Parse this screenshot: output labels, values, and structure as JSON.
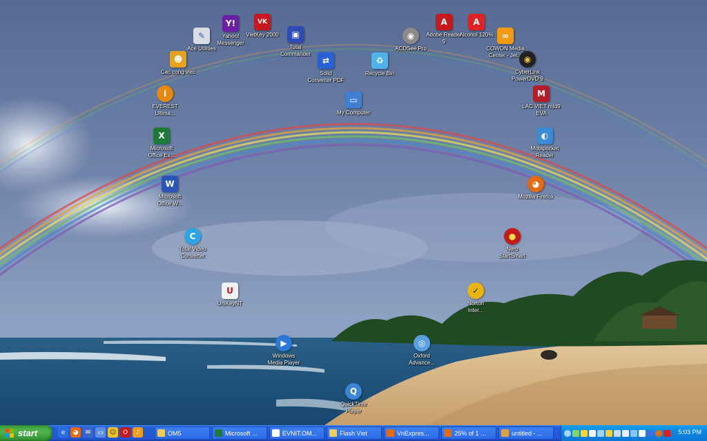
{
  "desktop_icons": [
    {
      "id": "ace-utilities",
      "label": "Ace Utilities",
      "icon": "ace-utilities-icon",
      "color": "#d8dce4",
      "glyph": "✎"
    },
    {
      "id": "yahoo-messenger",
      "label": "Yahoo!\nMessenger",
      "icon": "yahoo-messenger-icon",
      "color": "#6b1fa6",
      "glyph": "Y!"
    },
    {
      "id": "vietkey-2000",
      "label": "VietKey 2000",
      "icon": "vietkey-icon",
      "color": "#c8171d",
      "glyph": "VK"
    },
    {
      "id": "total-commander",
      "label": "Total\nCommander",
      "icon": "total-commander-icon",
      "color": "#2f4bb8",
      "glyph": "▣"
    },
    {
      "id": "acdsee-pro",
      "label": "ACDSee Pro",
      "icon": "acdsee-icon",
      "color": "#8a8a8a",
      "glyph": "◉"
    },
    {
      "id": "adobe-reader",
      "label": "Adobe Reader\n9",
      "icon": "adobe-reader-icon",
      "color": "#c8171d",
      "glyph": "A"
    },
    {
      "id": "alcohol-120",
      "label": "Alcohol 120%",
      "icon": "alcohol-icon",
      "color": "#e02222",
      "glyph": "A"
    },
    {
      "id": "cac-cong-viec",
      "label": "Cac cong viec",
      "icon": "person-icon",
      "color": "#e5a21c",
      "glyph": "☻"
    },
    {
      "id": "cowon-media-center",
      "label": "COWON Media\nCenter - Jet...",
      "icon": "cowon-icon",
      "color": "#f09b12",
      "glyph": "∞"
    },
    {
      "id": "solid-converter-pdf",
      "label": "Solid\nConverter PDF",
      "icon": "pdf-converter-icon",
      "color": "#2a5fd6",
      "glyph": "⇄"
    },
    {
      "id": "recycle-bin",
      "label": "Recycle Bin",
      "icon": "recycle-bin-icon",
      "color": "#4fb2e8",
      "glyph": "♻"
    },
    {
      "id": "cyberlink-powerdvd",
      "label": "CyberLink\nPowerDVD 9",
      "icon": "powerdvd-icon",
      "color": "#222222",
      "glyph": "◉"
    },
    {
      "id": "everest",
      "label": "EVEREST\nUltima...",
      "icon": "info-icon",
      "color": "#e58a0c",
      "glyph": "i"
    },
    {
      "id": "my-computer",
      "label": "My Computer",
      "icon": "my-computer-icon",
      "color": "#3e7fd3",
      "glyph": "▭"
    },
    {
      "id": "lac-viet",
      "label": "LAC VIET mtd9\nEVA",
      "icon": "lac-viet-icon",
      "color": "#b51d2a",
      "glyph": "M"
    },
    {
      "id": "microsoft-excel",
      "label": "Microsoft\nOffice Ex...",
      "icon": "excel-icon",
      "color": "#1f7a3a",
      "glyph": "X"
    },
    {
      "id": "mobipocket-reader",
      "label": "Mobipocket\nReader",
      "icon": "mobipocket-icon",
      "color": "#3a8ad6",
      "glyph": "◐"
    },
    {
      "id": "microsoft-word",
      "label": "Microsoft\nOffice W...",
      "icon": "word-icon",
      "color": "#2b55b8",
      "glyph": "W"
    },
    {
      "id": "mozilla-firefox",
      "label": "Mozilla Firefox",
      "icon": "firefox-icon",
      "color": "#e56a10",
      "glyph": "◕"
    },
    {
      "id": "total-video-converter",
      "label": "Total Video\nConverter",
      "icon": "video-converter-icon",
      "color": "#2ea4e8",
      "glyph": "C"
    },
    {
      "id": "nero-startsmart",
      "label": "Nero\nStartSmart",
      "icon": "nero-icon",
      "color": "#c41a1a",
      "glyph": "●"
    },
    {
      "id": "unikey-nt",
      "label": "UniKeyNT",
      "icon": "unikey-icon",
      "color": "#f2f2f2",
      "glyph": "U"
    },
    {
      "id": "norton-internet",
      "label": "Norton\nInter...",
      "icon": "norton-icon",
      "color": "#e8b40f",
      "glyph": "✓"
    },
    {
      "id": "windows-media-player",
      "label": "Windows\nMedia Player",
      "icon": "media-player-icon",
      "color": "#2a79d8",
      "glyph": "▶"
    },
    {
      "id": "oxford-advanced",
      "label": "Oxford\nAdvance...",
      "icon": "oxford-icon",
      "color": "#5aa0e0",
      "glyph": "◎"
    },
    {
      "id": "quicktime-player",
      "label": "QuickTime\nPlayer",
      "icon": "quicktime-icon",
      "color": "#3b86d6",
      "glyph": "Q"
    }
  ],
  "taskbar": {
    "start_label": "start",
    "quick_launch": [
      {
        "icon": "internet-explorer-icon",
        "color": "#2a6fe0",
        "glyph": "e"
      },
      {
        "icon": "firefox-icon",
        "color": "#e56a10",
        "glyph": "◕"
      },
      {
        "icon": "thunderbird-icon",
        "color": "#3a67c9",
        "glyph": "✉"
      },
      {
        "icon": "show-desktop-icon",
        "color": "#5b8fe5",
        "glyph": "▭"
      },
      {
        "icon": "yahoo-messenger-icon",
        "color": "#f2c21c",
        "glyph": "☺"
      },
      {
        "icon": "opera-icon",
        "color": "#c41a1a",
        "glyph": "O"
      },
      {
        "icon": "media-icon",
        "color": "#ee9d1a",
        "glyph": "♪"
      }
    ],
    "tasks": [
      {
        "label": "OM5",
        "icon": "folder-icon",
        "color": "#f0cc55"
      },
      {
        "label": "Microsoft ...",
        "icon": "excel-icon",
        "color": "#1f7a3a"
      },
      {
        "label": "EVNIT.OM...",
        "icon": "document-icon",
        "color": "#ffffff"
      },
      {
        "label": "Flash Viet",
        "icon": "folder-icon",
        "color": "#f0cc55"
      },
      {
        "label": "VnExpres...",
        "icon": "firefox-icon",
        "color": "#e56a10"
      },
      {
        "label": "25% of 1 ...",
        "icon": "firefox-icon",
        "color": "#e56a10"
      },
      {
        "label": "untitled - ...",
        "icon": "paint-icon",
        "color": "#d9a441"
      }
    ],
    "tray_icons": [
      {
        "icon": "tray-arrow-icon",
        "color": "#a9d3ff"
      },
      {
        "icon": "tray-network-icon",
        "color": "#7fd36b"
      },
      {
        "icon": "tray-shield-icon",
        "color": "#ffd23a"
      },
      {
        "icon": "tray-unikey-icon",
        "color": "#f2f2f2"
      },
      {
        "icon": "tray-eye-icon",
        "color": "#9ed4ff"
      },
      {
        "icon": "tray-messenger-icon",
        "color": "#f6cf3a"
      },
      {
        "icon": "tray-tool-icon",
        "color": "#c6dbff"
      },
      {
        "icon": "tray-speaker-icon",
        "color": "#e8f0ff"
      },
      {
        "icon": "tray-display-icon",
        "color": "#87c5ff"
      },
      {
        "icon": "tray-infinity-icon",
        "color": "#ffffff"
      },
      {
        "icon": "tray-bluetooth-icon",
        "color": "#3d6fe0"
      },
      {
        "icon": "tray-firefox-icon",
        "color": "#e56a10"
      },
      {
        "icon": "tray-red-icon",
        "color": "#d92020"
      }
    ],
    "clock": "5:03 PM"
  },
  "colors": {
    "sky_top": "#5b6d95",
    "sea": "#1c4d78",
    "sand": "#d8b98a",
    "taskbar": "#245edc",
    "start": "#3c9f3c"
  }
}
